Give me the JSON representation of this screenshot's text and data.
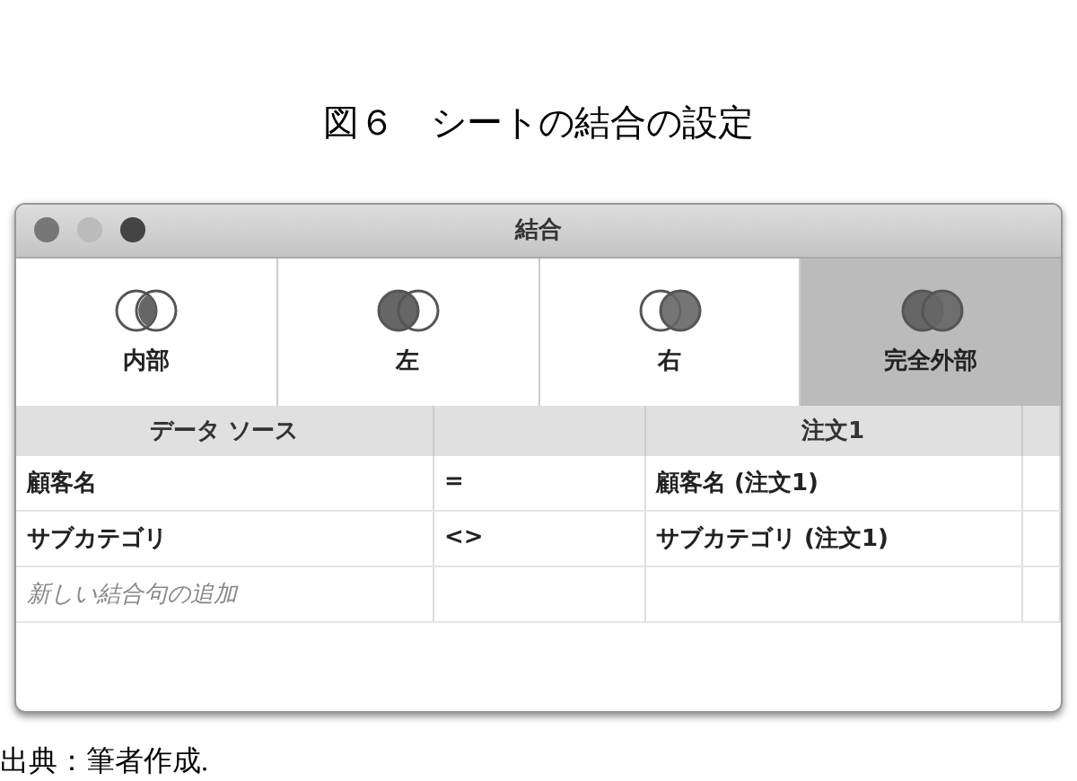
{
  "caption": "図６　シートの結合の設定",
  "window": {
    "title": "結合"
  },
  "join_types": [
    {
      "label": "内部",
      "kind": "inner",
      "selected": false
    },
    {
      "label": "左",
      "kind": "left",
      "selected": false
    },
    {
      "label": "右",
      "kind": "right",
      "selected": false
    },
    {
      "label": "完全外部",
      "kind": "full",
      "selected": true
    }
  ],
  "table": {
    "columns": [
      "データ ソース",
      "",
      "注文1"
    ],
    "rows": [
      {
        "kind": "clause",
        "cells": [
          "顧客名",
          "=",
          "顧客名 (注文1)"
        ]
      },
      {
        "kind": "clause",
        "cells": [
          "サブカテゴリ",
          "<>",
          "サブカテゴリ (注文1)"
        ]
      },
      {
        "kind": "add",
        "cells": [
          "新しい結合句の追加"
        ]
      }
    ]
  },
  "source": "出典：筆者作成."
}
